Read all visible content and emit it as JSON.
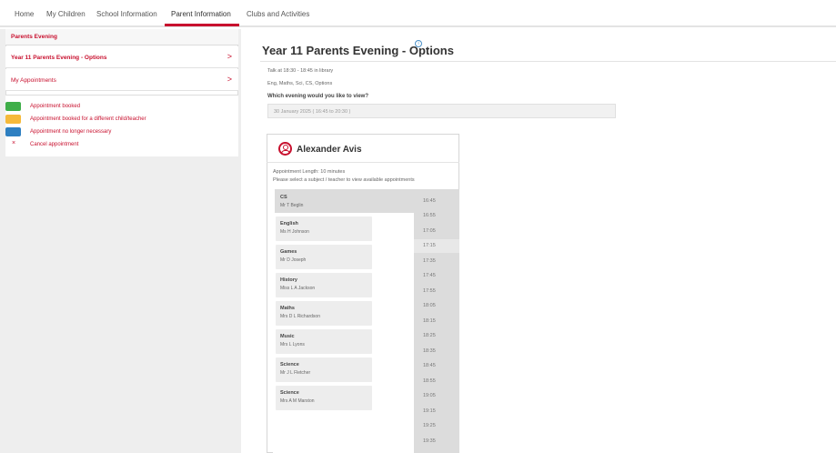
{
  "nav": {
    "tabs": [
      {
        "label": "Home"
      },
      {
        "label": "My Children"
      },
      {
        "label": "School Information"
      },
      {
        "label": "Parent Information"
      },
      {
        "label": "Clubs and Activities"
      }
    ],
    "active_index": 3
  },
  "sidebar": {
    "header": "Parents Evening",
    "items": [
      {
        "label": "Year 11 Parents Evening - Options",
        "chevron": ">"
      },
      {
        "label": "My Appointments",
        "chevron": ">"
      }
    ],
    "legend": [
      {
        "label": "Appointment booked",
        "color": "#3fae49"
      },
      {
        "label": "Appointment booked for a different child/teacher",
        "color": "#f5b93a"
      },
      {
        "label": "Appointment no longer necessary",
        "color": "#2e7fc1"
      },
      {
        "label": "Cancel appointment",
        "symbol": "×"
      }
    ]
  },
  "main": {
    "title": "Year 11 Parents Evening - Options",
    "info_glyph": "i",
    "meta_lines": [
      "Talk at 18:30 - 18:45 in library",
      "Eng, Maths, Sci, CS, Options"
    ],
    "question": "Which evening would you like to view?",
    "selected_evening": "30 January 2025 ( 16:45 to 20:30 )",
    "student": {
      "name": "Alexander Avis",
      "appointment_length": "Appointment Length: 10 minutes",
      "instruction": "Please select a subject / teacher to view available appointments"
    },
    "subjects": [
      {
        "subject": "CS",
        "teacher": "Mr T Beglin"
      },
      {
        "subject": "English",
        "teacher": "Ms H Johnson"
      },
      {
        "subject": "Games",
        "teacher": "Mr D Joseph"
      },
      {
        "subject": "History",
        "teacher": "Miss L A Jackson"
      },
      {
        "subject": "Maths",
        "teacher": "Mrs D L Richardson"
      },
      {
        "subject": "Music",
        "teacher": "Mrs L Lyons"
      },
      {
        "subject": "Science",
        "teacher": "Mr J L Fletcher"
      },
      {
        "subject": "Science",
        "teacher": "Mrs A M Marston"
      }
    ],
    "time_slots": [
      "16:45",
      "16:55",
      "17:05",
      "17:15",
      "17:35",
      "17:45",
      "17:55",
      "18:05",
      "18:15",
      "18:25",
      "18:35",
      "18:45",
      "18:55",
      "19:05",
      "19:15",
      "19:25",
      "19:35"
    ]
  },
  "colors": {
    "accent": "#c8102e",
    "info": "#4a90c8"
  }
}
